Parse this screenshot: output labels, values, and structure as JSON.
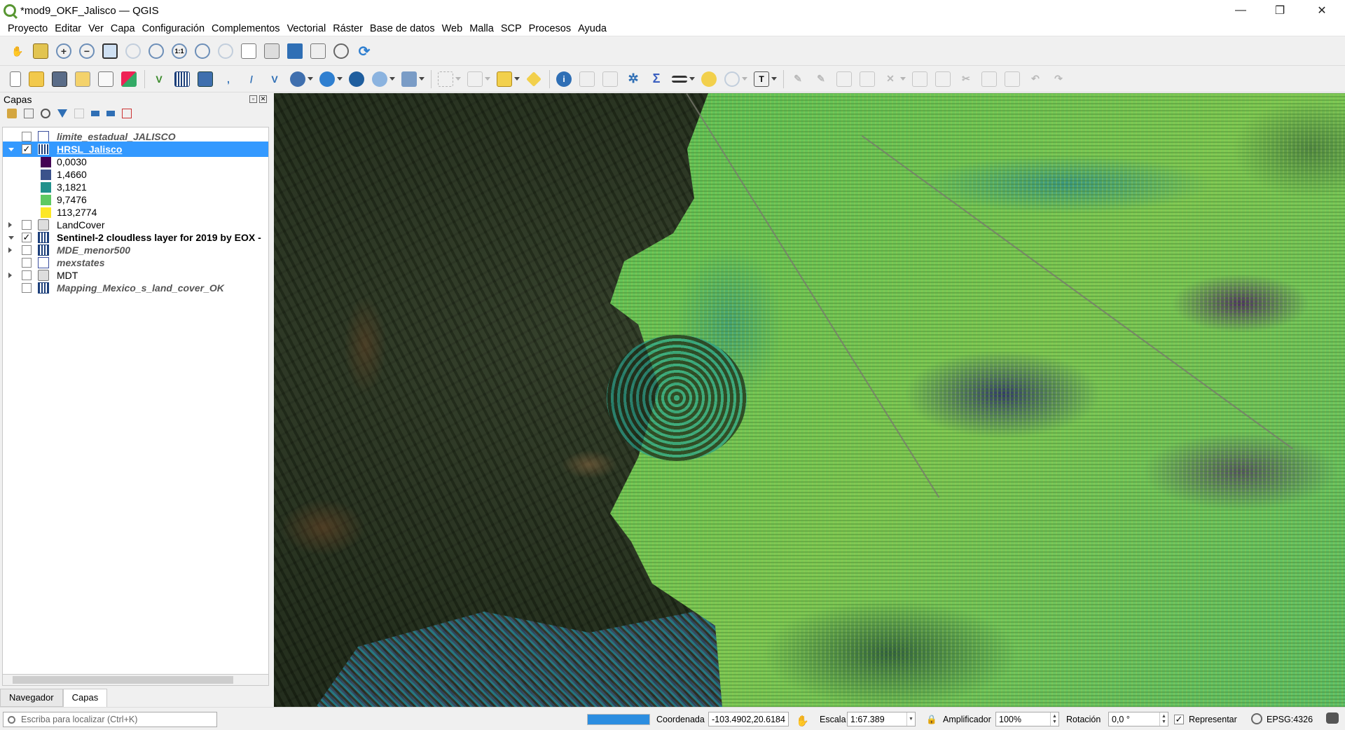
{
  "window": {
    "title": "*mod9_OKF_Jalisco — QGIS",
    "minimize": "—",
    "restore": "❐",
    "close": "✕"
  },
  "menu": [
    "Proyecto",
    "Editar",
    "Ver",
    "Capa",
    "Configuración",
    "Complementos",
    "Vectorial",
    "Ráster",
    "Base de datos",
    "Web",
    "Malla",
    "SCP",
    "Procesos",
    "Ayuda"
  ],
  "toolbar_nav": [
    "pan-icon",
    "pan-to-selection-icon",
    "zoom-in-icon",
    "zoom-out-icon",
    "zoom-full-icon",
    "zoom-to-selection-icon",
    "zoom-to-layer-icon",
    "zoom-native-icon",
    "zoom-last-icon",
    "zoom-next-icon",
    "new-bookmark-icon",
    "show-bookmarks-icon",
    "new-map-view-icon",
    "bookmarks-icon",
    "temporal-controller-icon",
    "refresh-icon"
  ],
  "toolbar_main": [
    "new-project-icon",
    "open-project-icon",
    "save-project-icon",
    "print-layout-icon",
    "layout-manager-icon",
    "style-manager-icon",
    "add-vector-icon",
    "add-raster-icon",
    "add-mesh-icon",
    "add-delimited-icon",
    "digitize-icon",
    "add-virtual-icon",
    "wms-icon",
    "add-wfs-icon",
    "add-xyz-icon",
    "new-layer-icon",
    "select-icon",
    "deselect-icon",
    "select-by-expr-icon",
    "annotation-icon",
    "identify-icon",
    "attribute-table-icon",
    "field-calculator-icon",
    "processing-icon",
    "statistics-icon",
    "measure-icon",
    "map-tips-icon",
    "locator-icon",
    "text-annotation-icon",
    "edit-pencil-icon",
    "digitize-icon",
    "save-edits-icon",
    "add-feature-icon",
    "vertex-tool-icon",
    "edit-attrs-icon",
    "delete-icon",
    "cut-icon",
    "copy-icon",
    "paste-icon",
    "undo-icon",
    "redo-icon"
  ],
  "layers_panel": {
    "title": "Capas",
    "layers": [
      {
        "name": "limite_estadual_JALISCO",
        "checked": false,
        "style": "italic",
        "icon": "vector"
      },
      {
        "name": "HRSL_Jalisco",
        "checked": true,
        "style": "selected",
        "icon": "raster",
        "expanded": true
      },
      {
        "name": "LandCover",
        "checked": false,
        "style": "normal",
        "icon": "wms",
        "expander": "closed"
      },
      {
        "name": "Sentinel-2 cloudless layer for 2019 by EOX -",
        "checked": true,
        "style": "bold",
        "icon": "raster",
        "expander": "open"
      },
      {
        "name": "MDE_menor500",
        "checked": false,
        "style": "italic",
        "icon": "raster",
        "expander": "closed"
      },
      {
        "name": "mexstates",
        "checked": false,
        "style": "italic",
        "icon": "vector"
      },
      {
        "name": "MDT",
        "checked": false,
        "style": "normal",
        "icon": "wms",
        "expander": "closed"
      },
      {
        "name": "Mapping_Mexico_s_land_cover_OK",
        "checked": false,
        "style": "italic",
        "icon": "raster"
      }
    ],
    "legend": [
      {
        "label": "0,0030",
        "color": "#440154"
      },
      {
        "label": "1,4660",
        "color": "#3b528b"
      },
      {
        "label": "3,1821",
        "color": "#21918c"
      },
      {
        "label": "9,7476",
        "color": "#5ec962"
      },
      {
        "label": "113,2774",
        "color": "#fde725"
      }
    ],
    "check_mark": "✓"
  },
  "tabs": {
    "navigator": "Navegador",
    "layers": "Capas"
  },
  "status": {
    "locator_placeholder": "Escriba para localizar (Ctrl+K)",
    "progress_fraction": 1.0,
    "coord_label": "Coordenada",
    "coord_value": "-103.4902,20.6184",
    "scale_label": "Escala",
    "scale_value": "1:67.389",
    "magnifier_label": "Amplificador",
    "magnifier_value": "100%",
    "rotation_label": "Rotación",
    "rotation_value": "0,0 °",
    "render_label": "Representar",
    "crs": "EPSG:4326"
  }
}
